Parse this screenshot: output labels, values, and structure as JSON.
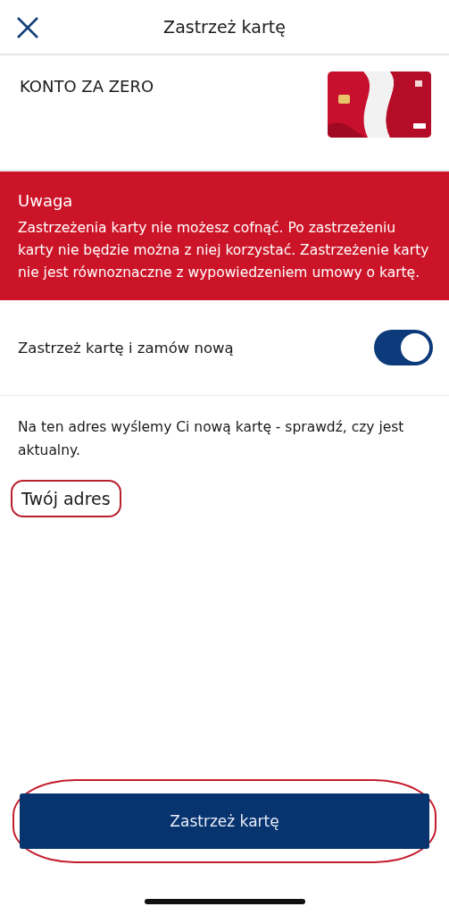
{
  "header": {
    "title": "Zastrzeż kartę"
  },
  "product": {
    "name": "KONTO ZA ZERO"
  },
  "warning": {
    "title": "Uwaga",
    "text": "Zastrzeżenia karty nie możesz cofnąć. Po zastrzeżeniu karty nie będzie można z niej korzystać. Zastrzeżenie karty nie jest równoznaczne z wypowiedzeniem umowy o kartę."
  },
  "toggle": {
    "label": "Zastrzeż kartę i zamów nową",
    "on": true
  },
  "info": "Na ten adres wyślemy Ci nową kartę - sprawdź, czy jest aktualny.",
  "address": {
    "label": "Twój adres",
    "highlighted": true
  },
  "submit": {
    "label": "Zastrzeż kartę",
    "highlighted": true
  }
}
